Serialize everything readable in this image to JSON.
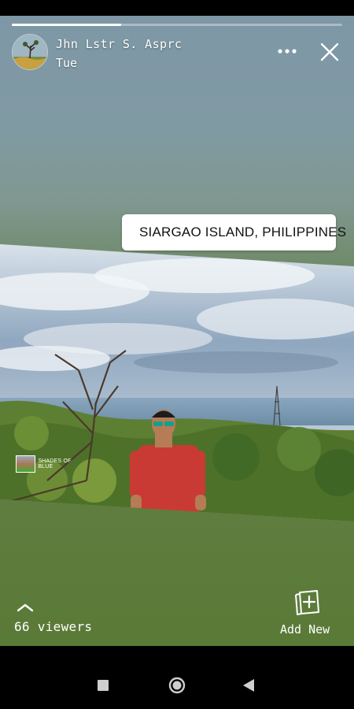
{
  "story": {
    "progress_fraction": 0.33,
    "user": {
      "name": "Jhn Lstr S. Asprc",
      "time": "Tue"
    },
    "location_sticker": {
      "label": "SIARGAO ISLAND, PHILIPPINES",
      "icon": "map-pin-icon",
      "icon_color": "#2aa7e0"
    },
    "mini_sticker": {
      "label": "SHADES OF BLUE"
    },
    "footer": {
      "viewers_label": "66 viewers",
      "add_new_label": "Add New"
    }
  },
  "icons": {
    "more": "more-horizontal-icon",
    "close": "close-icon",
    "viewers": "chevron-up-icon",
    "add_new": "add-to-story-icon"
  },
  "navbar": {
    "buttons": [
      "recents-button",
      "home-button",
      "back-button"
    ]
  }
}
